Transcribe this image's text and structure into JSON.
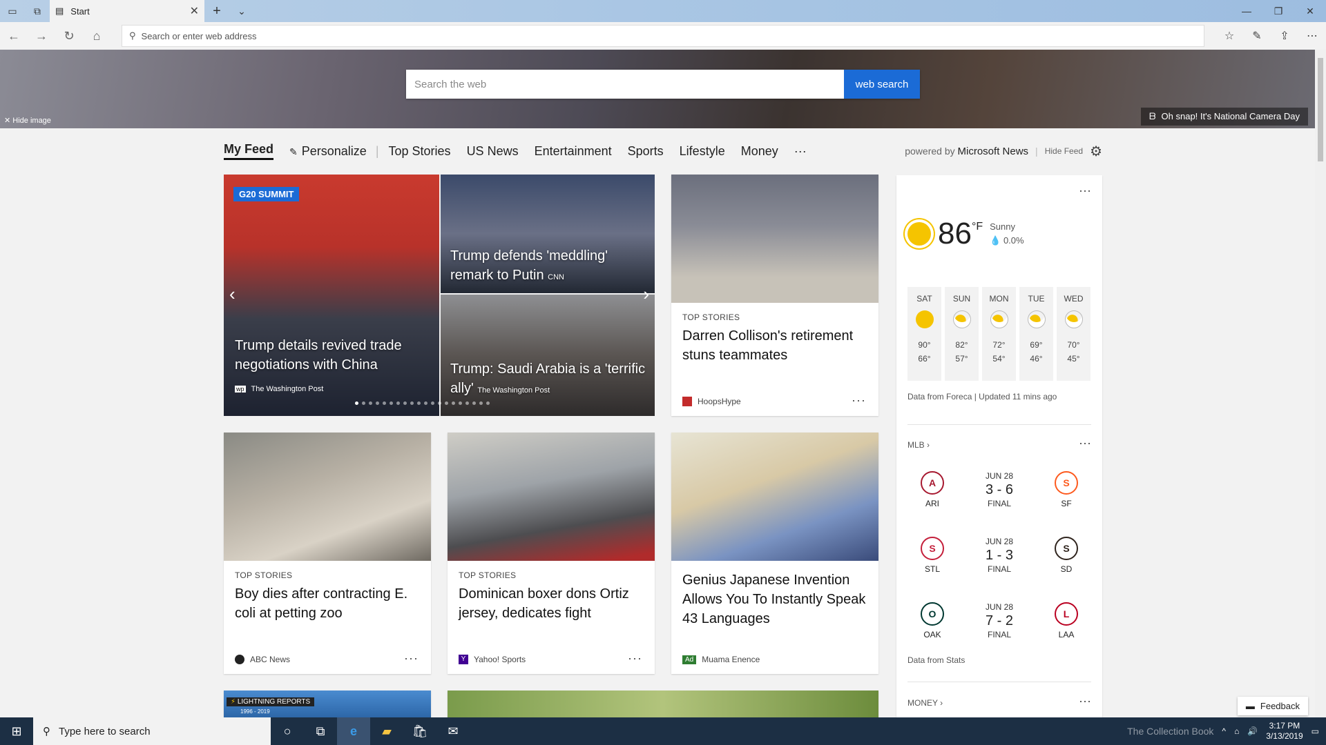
{
  "browser": {
    "tab_title": "Start",
    "address_placeholder": "Search or enter web address"
  },
  "hero": {
    "search_placeholder": "Search the web",
    "search_button": "web search",
    "hide_image": "Hide image",
    "daily_caption": "Oh snap! It's National Camera Day"
  },
  "feedbar": {
    "items": [
      "My Feed",
      "Personalize",
      "Top Stories",
      "US News",
      "Entertainment",
      "Sports",
      "Lifestyle",
      "Money",
      "···"
    ],
    "powered_by": "powered by",
    "provider": "Microsoft News",
    "hide_feed": "Hide Feed"
  },
  "carousel": {
    "badge": "G20 SUMMIT",
    "main_headline": "Trump details revived trade negotiations with China",
    "main_source": "The Washington Post",
    "side1_headline": "Trump defends 'meddling' remark to Putin",
    "side1_source": "CNN",
    "side2_headline": "Trump: Saudi Arabia is a 'terrific ally'",
    "side2_source": "The Washington Post",
    "active_slide": 1,
    "slide_count": 20
  },
  "cards": [
    {
      "category": "TOP STORIES",
      "headline": "Darren Collison's retirement stuns teammates",
      "source": "HoopsHype"
    },
    {
      "category": "TOP STORIES",
      "headline": "Boy dies after contracting E. coli at petting zoo",
      "source": "ABC News"
    },
    {
      "category": "TOP STORIES",
      "headline": "Dominican boxer dons Ortiz jersey, dedicates fight",
      "source": "Yahoo! Sports"
    },
    {
      "category": "",
      "headline": "Genius Japanese Invention Allows You To Instantly Speak 43 Languages",
      "source": "Muama Enence",
      "ad": "Ad"
    }
  ],
  "partial_card": {
    "label": "LIGHTNING REPORTS",
    "sub": "1996 - 2019"
  },
  "weather": {
    "temp": "86",
    "unit": "°F",
    "condition": "Sunny",
    "precip": "0.0%",
    "forecast": [
      {
        "day": "SAT",
        "hi": "90°",
        "lo": "66°",
        "icon": "sun"
      },
      {
        "day": "SUN",
        "hi": "82°",
        "lo": "57°",
        "icon": "partly-cloudy"
      },
      {
        "day": "MON",
        "hi": "72°",
        "lo": "54°",
        "icon": "partly-cloudy"
      },
      {
        "day": "TUE",
        "hi": "69°",
        "lo": "46°",
        "icon": "partly-cloudy"
      },
      {
        "day": "WED",
        "hi": "70°",
        "lo": "45°",
        "icon": "partly-cloudy"
      }
    ],
    "source": "Data from Foreca | Updated 11 mins ago"
  },
  "mlb": {
    "title": "MLB",
    "games": [
      {
        "date": "JUN 28",
        "score": "3 - 6",
        "status": "FINAL",
        "home": "ARI",
        "away": "SF",
        "home_color": "#a71930",
        "away_color": "#fd5a1e"
      },
      {
        "date": "JUN 28",
        "score": "1 - 3",
        "status": "FINAL",
        "home": "STL",
        "away": "SD",
        "home_color": "#c41e3a",
        "away_color": "#2f241d"
      },
      {
        "date": "JUN 28",
        "score": "7 - 2",
        "status": "FINAL",
        "home": "OAK",
        "away": "LAA",
        "home_color": "#003831",
        "away_color": "#ba0021"
      }
    ],
    "source": "Data from Stats"
  },
  "money": {
    "title": "MONEY"
  },
  "feedback": "Feedback",
  "taskbar": {
    "search_placeholder": "Type here to search",
    "time": "3:17 PM",
    "date": "3/13/2019",
    "watermark": "The Collection Book"
  },
  "colors": {
    "accent": "#1b6bd6",
    "taskbar": "#1c2f44"
  }
}
